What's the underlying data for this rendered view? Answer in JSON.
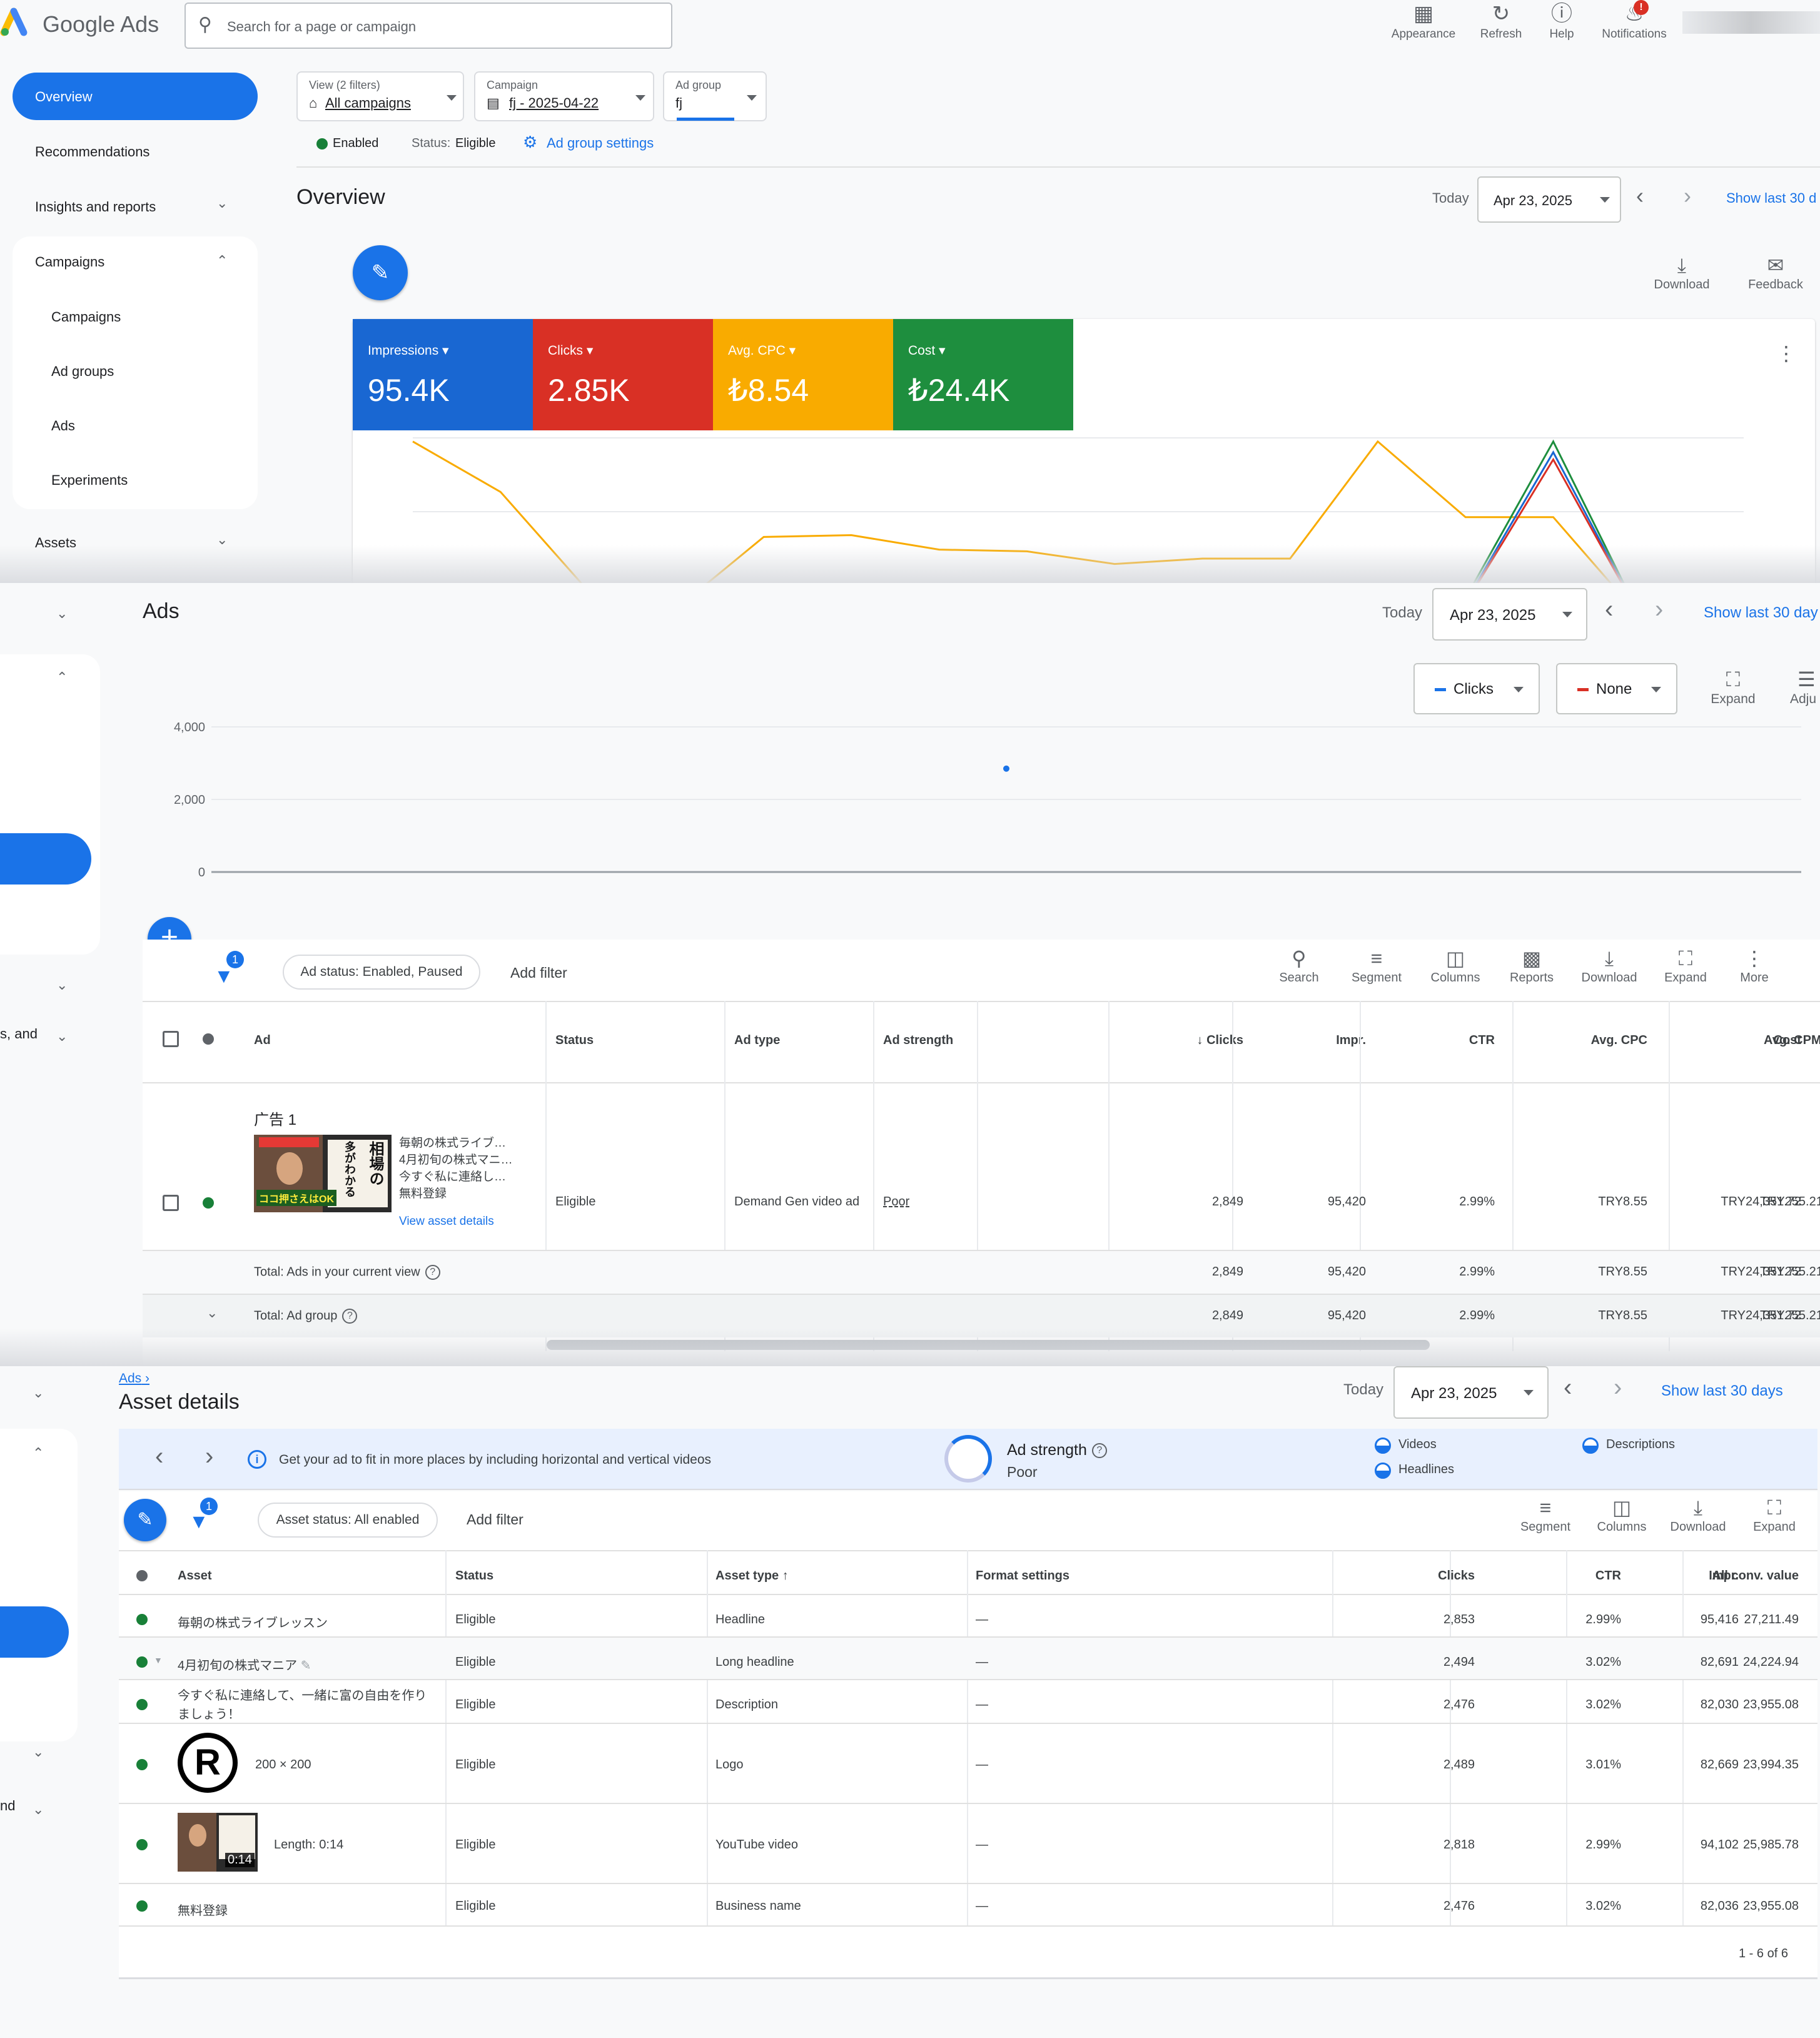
{
  "header": {
    "app_name": "Google Ads",
    "search_placeholder": "Search for a page or campaign",
    "appearance": "Appearance",
    "refresh": "Refresh",
    "help": "Help",
    "notifications": "Notifications",
    "notifications_badge": "!"
  },
  "sidebar": {
    "overview": "Overview",
    "recommendations": "Recommendations",
    "insights": "Insights and reports",
    "campaigns_group": "Campaigns",
    "campaigns": "Campaigns",
    "ad_groups": "Ad groups",
    "ads": "Ads",
    "experiments": "Experiments",
    "assets": "Assets",
    "partial_text_2": "s, and",
    "partial_text_3": "nd"
  },
  "filters": {
    "view_label": "View (2 filters)",
    "view_value": "All campaigns",
    "campaign_label": "Campaign",
    "campaign_value": "fj - 2025-04-22",
    "adgroup_label": "Ad group",
    "adgroup_value": "fj",
    "enabled": "Enabled",
    "status_label": "Status:",
    "status_value": "Eligible",
    "settings_link": "Ad group settings"
  },
  "date": {
    "today": "Today",
    "value": "Apr 23, 2025",
    "show_last_1": "Show last 30 d",
    "show_last_2": "Show last 30 day",
    "show_last_3": "Show last 30 days"
  },
  "overview": {
    "title": "Overview",
    "download": "Download",
    "feedback": "Feedback",
    "tiles": [
      {
        "label": "Impressions",
        "value": "95.4K",
        "color": "#1967d2"
      },
      {
        "label": "Clicks",
        "value": "2.85K",
        "color": "#d93025"
      },
      {
        "label": "Avg. CPC",
        "value": "₺8.54",
        "color": "#f9ab00"
      },
      {
        "label": "Cost",
        "value": "₺24.4K",
        "color": "#1e8e3e"
      }
    ],
    "chart_data": {
      "type": "line",
      "series": [
        {
          "color": "#f9ab00",
          "values": [
            0.98,
            0.7,
            0.15,
            0.05,
            0.45,
            0.46,
            0.38,
            0.37,
            0.3,
            0.33,
            0.33,
            0.98,
            0.56,
            0.56,
            0.0,
            0.0
          ]
        },
        {
          "color": "#1e8e3e",
          "values": [
            0.0,
            0.0,
            0.0,
            0.0,
            0.0,
            0.0,
            0.0,
            0.0,
            0.0,
            0.0,
            0.0,
            0.14,
            0.11,
            0.98,
            0.0,
            0.0
          ]
        },
        {
          "color": "#1967d2",
          "values": [
            0.0,
            0.0,
            0.0,
            0.0,
            0.0,
            0.0,
            0.0,
            0.0,
            0.0,
            0.0,
            0.0,
            0.12,
            0.09,
            0.92,
            0.0,
            0.0
          ]
        },
        {
          "color": "#d93025",
          "values": [
            0.0,
            0.0,
            0.0,
            0.0,
            0.0,
            0.0,
            0.0,
            0.0,
            0.0,
            0.0,
            0.0,
            0.1,
            0.08,
            0.88,
            0.0,
            0.0
          ]
        }
      ]
    }
  },
  "ads_section": {
    "title": "Ads",
    "metric1": "Clicks",
    "metric2": "None",
    "expand": "Expand",
    "adjust": "Adju",
    "chart_data": {
      "type": "scatter",
      "y_ticks": [
        "4,000",
        "2,000",
        "0"
      ],
      "ylim": [
        0,
        4000
      ],
      "points": [
        {
          "x": 0.5,
          "y": 2849
        }
      ]
    },
    "filter_badge": "1",
    "filter_chip": "Ad status: Enabled, Paused",
    "add_filter": "Add filter",
    "toolbar": [
      "Search",
      "Segment",
      "Columns",
      "Reports",
      "Download",
      "Expand",
      "More"
    ],
    "columns": [
      "Ad",
      "Status",
      "Ad type",
      "Ad strength",
      "Clicks",
      "Impr.",
      "CTR",
      "Avg. CPC",
      "Cost",
      "Avg. CPM"
    ],
    "ad": {
      "name": "广告 1",
      "lines": [
        "毎朝の株式ライブ…",
        "4月初旬の株式マニ…",
        "今すぐ私に連絡し…",
        "無料登録"
      ],
      "view_details": "View asset details",
      "status": "Eligible",
      "type": "Demand Gen video ad",
      "strength": "Poor",
      "clicks": "2,849",
      "impr": "95,420",
      "ctr": "2.99%",
      "cpc": "TRY8.55",
      "cost": "TRY24,351.72",
      "cpm": "TRY255.21",
      "thumb_text_1": "相場の",
      "thumb_text_2": "多がわかる",
      "thumb_text_3": "ココ押さえはOK"
    },
    "total_view": {
      "label": "Total: Ads in your current view",
      "clicks": "2,849",
      "impr": "95,420",
      "ctr": "2.99%",
      "cpc": "TRY8.55",
      "cost": "TRY24,351.72",
      "cpm": "TRY255.21"
    },
    "total_group": {
      "label": "Total: Ad group",
      "clicks": "2,849",
      "impr": "95,420",
      "ctr": "2.99%",
      "cpc": "TRY8.55",
      "cost": "TRY24,351.72",
      "cpm": "TRY255.21"
    }
  },
  "asset_section": {
    "breadcrumb": "Ads",
    "title": "Asset details",
    "info": "Get your ad to fit in more places by including horizontal and vertical videos",
    "strength_label": "Ad strength",
    "strength_value": "Poor",
    "legend": [
      "Videos",
      "Headlines",
      "Descriptions"
    ],
    "filter_badge": "1",
    "filter_chip": "Asset status: All enabled",
    "add_filter": "Add filter",
    "toolbar": [
      "Segment",
      "Columns",
      "Download",
      "Expand"
    ],
    "columns": [
      "Asset",
      "Status",
      "Asset type",
      "Format settings",
      "Clicks",
      "CTR",
      "Impr.",
      "All conv. value"
    ],
    "rows": [
      {
        "asset": "毎朝の株式ライブレッスン",
        "status": "Eligible",
        "type": "Headline",
        "format": "—",
        "clicks": "2,853",
        "ctr": "2.99%",
        "impr": "95,416",
        "conv": "27,211.49"
      },
      {
        "asset": "4月初旬の株式マニア",
        "status": "Eligible",
        "type": "Long headline",
        "format": "—",
        "clicks": "2,494",
        "ctr": "3.02%",
        "impr": "82,691",
        "conv": "24,224.94"
      },
      {
        "asset": "今すぐ私に連絡して、一緒に富の自由を作りましょう！",
        "status": "Eligible",
        "type": "Description",
        "format": "—",
        "clicks": "2,476",
        "ctr": "3.02%",
        "impr": "82,030",
        "conv": "23,955.08"
      },
      {
        "asset": "200 × 200",
        "status": "Eligible",
        "type": "Logo",
        "format": "—",
        "clicks": "2,489",
        "ctr": "3.01%",
        "impr": "82,669",
        "conv": "23,994.35"
      },
      {
        "asset": "Length: 0:14",
        "status": "Eligible",
        "type": "YouTube video",
        "format": "—",
        "clicks": "2,818",
        "ctr": "2.99%",
        "impr": "94,102",
        "conv": "25,985.78"
      },
      {
        "asset": "無料登録",
        "status": "Eligible",
        "type": "Business name",
        "format": "—",
        "clicks": "2,476",
        "ctr": "3.02%",
        "impr": "82,036",
        "conv": "23,955.08"
      }
    ],
    "video_duration": "0:14",
    "pagination": "1 - 6 of 6"
  }
}
